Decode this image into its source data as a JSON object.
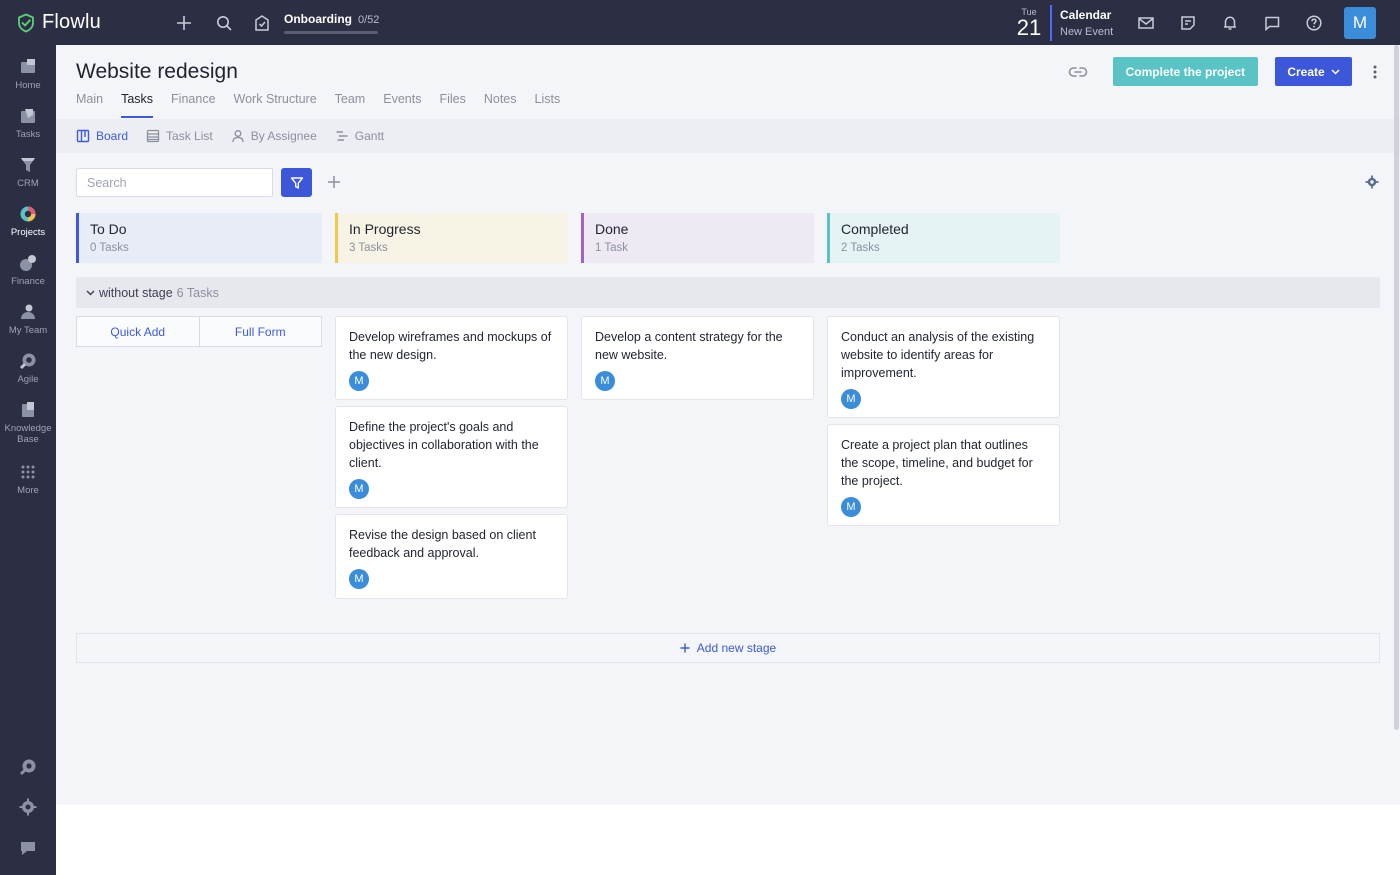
{
  "app": {
    "name": "Flowlu"
  },
  "topbar": {
    "onboarding": {
      "title": "Onboarding",
      "count": "0/52",
      "progress": 0
    },
    "calendar": {
      "day_of_week": "Tue",
      "day": "21",
      "title": "Calendar",
      "subtitle": "New Event"
    },
    "avatar_initial": "M"
  },
  "sidebar": {
    "items": [
      {
        "label": "Home",
        "icon": "home-icon"
      },
      {
        "label": "Tasks",
        "icon": "tasks-icon"
      },
      {
        "label": "CRM",
        "icon": "crm-icon"
      },
      {
        "label": "Projects",
        "icon": "projects-icon",
        "active": true
      },
      {
        "label": "Finance",
        "icon": "finance-icon"
      },
      {
        "label": "My Team",
        "icon": "team-icon"
      },
      {
        "label": "Agile",
        "icon": "agile-icon"
      },
      {
        "label": "Knowledge Base",
        "icon": "knowledge-base-icon"
      },
      {
        "label": "More",
        "icon": "grid-icon"
      }
    ]
  },
  "project": {
    "title": "Website redesign",
    "tabs": [
      "Main",
      "Tasks",
      "Finance",
      "Work Structure",
      "Team",
      "Events",
      "Files",
      "Notes",
      "Lists"
    ],
    "active_tab": "Tasks",
    "complete_label": "Complete the project",
    "create_label": "Create"
  },
  "views": {
    "items": [
      "Board",
      "Task List",
      "By Assignee",
      "Gantt"
    ],
    "active": "Board"
  },
  "toolbar": {
    "search_placeholder": "Search"
  },
  "stages": [
    {
      "name": "To Do",
      "count": "0 Tasks",
      "color": "#3b5bdb",
      "bg": "#e8ecf7"
    },
    {
      "name": "In Progress",
      "count": "3 Tasks",
      "color": "#f0c94a",
      "bg": "#f8f4e5"
    },
    {
      "name": "Done",
      "count": "1 Task",
      "color": "#a55fc9",
      "bg": "#efe9f4"
    },
    {
      "name": "Completed",
      "count": "2 Tasks",
      "color": "#5ac3c6",
      "bg": "#e6f3f5"
    }
  ],
  "group": {
    "name": "without stage",
    "count": "6 Tasks"
  },
  "quick_add": {
    "quick_label": "Quick Add",
    "full_label": "Full Form"
  },
  "cards": {
    "in_progress": [
      {
        "text": "Develop wireframes and mockups of the new design.",
        "assignee": "M"
      },
      {
        "text": "Define the project's goals and objectives in collaboration with the client.",
        "assignee": "M"
      },
      {
        "text": "Revise the design based on client feedback and approval.",
        "assignee": "M"
      }
    ],
    "done": [
      {
        "text": "Develop a content strategy for the new website.",
        "assignee": "M"
      }
    ],
    "completed": [
      {
        "text": "Conduct an analysis of the existing website to identify areas for improvement.",
        "assignee": "M"
      },
      {
        "text": "Create a project plan that outlines the scope, timeline, and budget for the project.",
        "assignee": "M"
      }
    ]
  },
  "add_stage_label": "Add new stage"
}
